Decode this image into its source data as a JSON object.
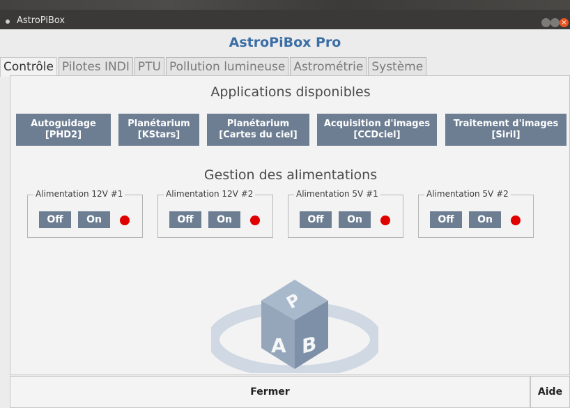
{
  "window": {
    "title": "AstroPiBox",
    "close_glyph": "×"
  },
  "header": {
    "title": "AstroPiBox Pro"
  },
  "tabs": [
    {
      "label": "Contrôle",
      "active": true
    },
    {
      "label": "Pilotes INDI"
    },
    {
      "label": "PTU"
    },
    {
      "label": "Pollution lumineuse"
    },
    {
      "label": "Astrométrie"
    },
    {
      "label": "Système"
    }
  ],
  "apps": {
    "title": "Applications disponibles",
    "buttons": [
      {
        "line1": "Autoguidage",
        "line2": "[PHD2]"
      },
      {
        "line1": "Planétarium",
        "line2": "[KStars]"
      },
      {
        "line1": "Planétarium",
        "line2": "[Cartes du ciel]"
      },
      {
        "line1": "Acquisition d'images",
        "line2": "[CCDciel]"
      },
      {
        "line1": "Traitement d'images",
        "line2": "[Siril]"
      }
    ]
  },
  "power": {
    "title": "Gestion des alimentations",
    "off_label": "Off",
    "on_label": "On",
    "status_color": "#e00000",
    "groups": [
      {
        "label": "Alimentation 12V #1"
      },
      {
        "label": "Alimentation 12V #2"
      },
      {
        "label": "Alimentation 5V #1"
      },
      {
        "label": "Alimentation 5V #2"
      }
    ]
  },
  "logo": {
    "letters": [
      "P",
      "A",
      "B"
    ]
  },
  "footer": {
    "close_label": "Fermer",
    "help_label": "Aide"
  },
  "colors": {
    "accent": "#3b6ea5",
    "button": "#6d7e93"
  }
}
